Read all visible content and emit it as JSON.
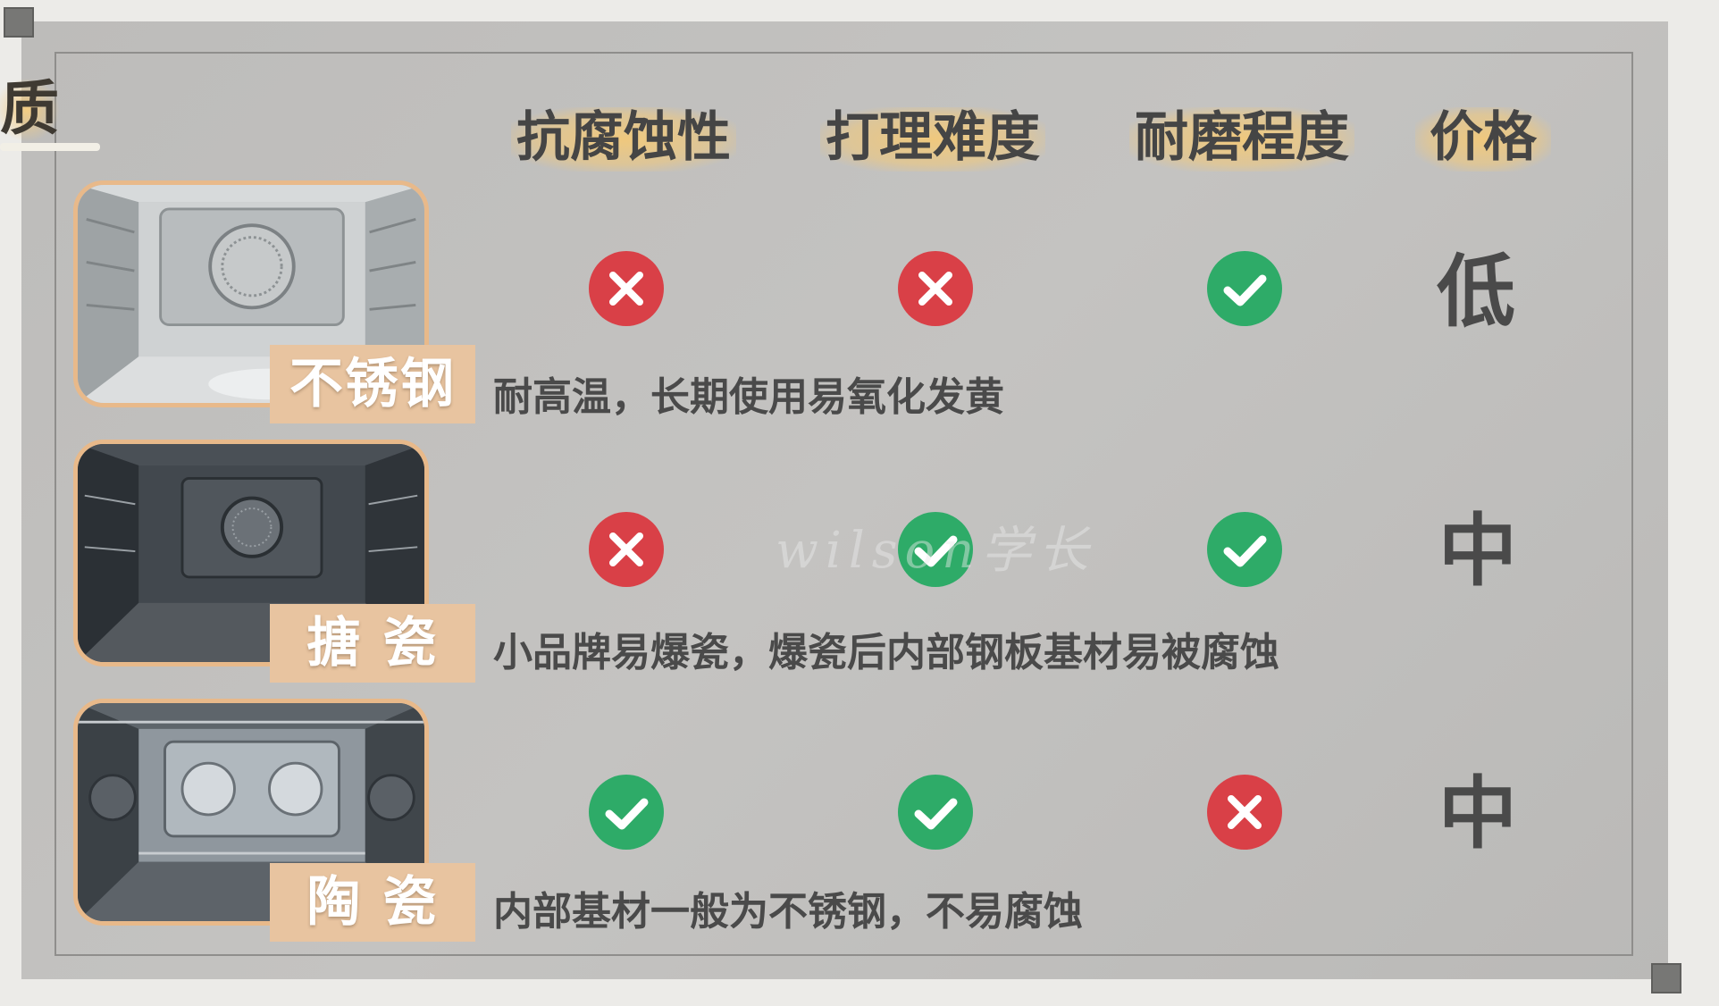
{
  "title_fragment": "质",
  "columns": [
    "抗腐蚀性",
    "打理难度",
    "耐磨程度",
    "价格"
  ],
  "rows": [
    {
      "material": "不锈钢",
      "marks": [
        "cross",
        "cross",
        "check"
      ],
      "price": "低",
      "description": "耐高温，长期使用易氧化发黄"
    },
    {
      "material": "搪 瓷",
      "marks": [
        "cross",
        "check",
        "check"
      ],
      "price": "中",
      "description": "小品牌易爆瓷，爆瓷后内部钢板基材易被腐蚀"
    },
    {
      "material": "陶 瓷",
      "marks": [
        "check",
        "check",
        "cross"
      ],
      "price": "中",
      "description": "内部基材一般为不锈钢，不易腐蚀"
    }
  ],
  "watermark": "wilson学长",
  "colors": {
    "cross": "#d94047",
    "check": "#2eab68",
    "label_bg": "#e8c4a0",
    "header_glow": "#f2c97a"
  }
}
